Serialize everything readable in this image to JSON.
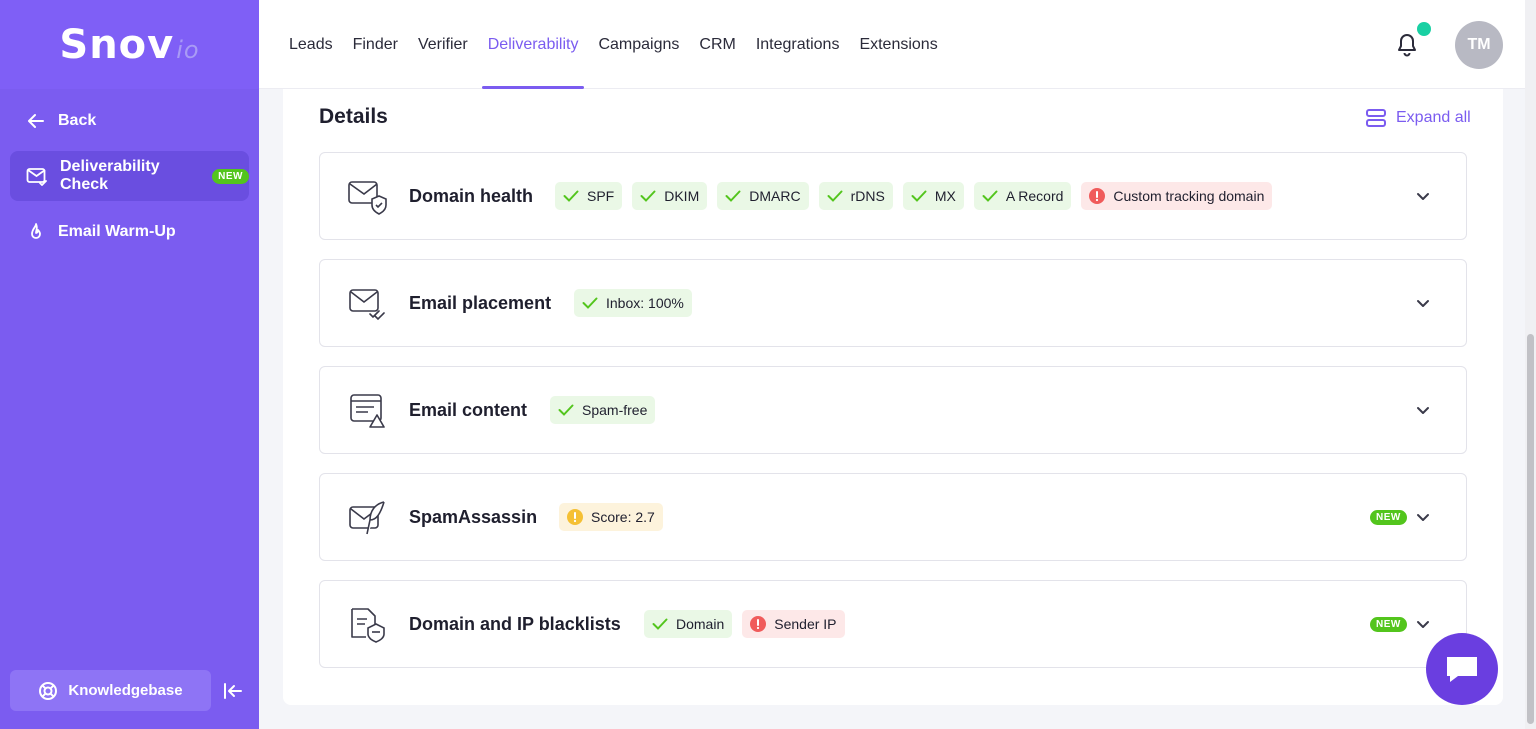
{
  "brand": {
    "name": "Snov",
    "suffix": "io"
  },
  "sidebar": {
    "back_label": "Back",
    "items": [
      {
        "label": "Deliverability Check",
        "badge": "NEW"
      },
      {
        "label": "Email Warm-Up"
      }
    ],
    "knowledgebase_label": "Knowledgebase"
  },
  "nav": {
    "items": [
      "Leads",
      "Finder",
      "Verifier",
      "Deliverability",
      "Campaigns",
      "CRM",
      "Integrations",
      "Extensions"
    ],
    "active": "Deliverability"
  },
  "user": {
    "initials": "TM"
  },
  "details": {
    "title": "Details",
    "expand_all_label": "Expand all",
    "rows": [
      {
        "title": "Domain health",
        "tags": [
          {
            "label": "SPF",
            "status": "ok"
          },
          {
            "label": "DKIM",
            "status": "ok"
          },
          {
            "label": "DMARC",
            "status": "ok"
          },
          {
            "label": "rDNS",
            "status": "ok"
          },
          {
            "label": "MX",
            "status": "ok"
          },
          {
            "label": "A Record",
            "status": "ok"
          },
          {
            "label": "Custom tracking domain",
            "status": "error"
          }
        ]
      },
      {
        "title": "Email placement",
        "tags": [
          {
            "label": "Inbox: 100%",
            "status": "ok"
          }
        ]
      },
      {
        "title": "Email content",
        "tags": [
          {
            "label": "Spam-free",
            "status": "ok"
          }
        ]
      },
      {
        "title": "SpamAssassin",
        "badge": "NEW",
        "tags": [
          {
            "label": "Score: 2.7",
            "status": "warning"
          }
        ]
      },
      {
        "title": "Domain and IP blacklists",
        "badge": "NEW",
        "tags": [
          {
            "label": "Domain",
            "status": "ok"
          },
          {
            "label": "Sender IP",
            "status": "error"
          }
        ]
      }
    ]
  },
  "colors": {
    "accent": "#7b5cf0",
    "ok": "#53c51d",
    "error": "#f05b5b",
    "warning": "#f5c034"
  }
}
